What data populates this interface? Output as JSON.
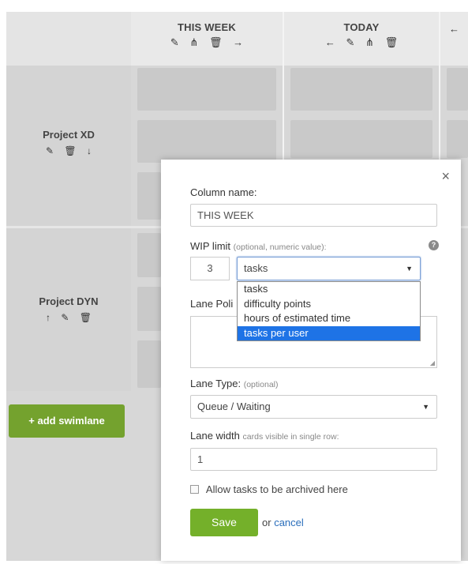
{
  "board": {
    "columns": [
      {
        "title": "THIS WEEK",
        "icons": [
          "pencil-icon",
          "hierarchy-icon",
          "trash-icon",
          "arrow-right-icon"
        ]
      },
      {
        "title": "TODAY",
        "icons": [
          "arrow-left-icon",
          "pencil-icon",
          "hierarchy-icon",
          "trash-icon"
        ]
      }
    ],
    "third_column_icon": "arrow-left-icon",
    "swimlanes": [
      {
        "name": "Project XD",
        "icons": [
          "pencil-icon",
          "trash-icon",
          "arrow-down-icon"
        ]
      },
      {
        "name": "Project DYN",
        "icons": [
          "arrow-up-icon",
          "pencil-icon",
          "trash-icon"
        ]
      }
    ],
    "add_swimlane_label": "+ add swimlane"
  },
  "modal": {
    "close_glyph": "×",
    "column_name_label": "Column name:",
    "column_name_value": "THIS WEEK",
    "wip_label": "WIP limit",
    "wip_hint": "(optional, numeric value):",
    "wip_value": "3",
    "wip_unit_selected": "tasks",
    "wip_unit_options": [
      "tasks",
      "difficulty points",
      "hours of estimated time",
      "tasks per user"
    ],
    "wip_unit_highlighted": "tasks per user",
    "lane_policy_label": "Lane Poli",
    "lane_type_label": "Lane Type:",
    "lane_type_hint": "(optional)",
    "lane_type_value": "Queue / Waiting",
    "lane_width_label": "Lane width",
    "lane_width_hint": "cards visible in single row:",
    "lane_width_value": "1",
    "archive_checkbox_label": "Allow tasks to be archived here",
    "archive_checked": false,
    "save_label": "Save",
    "or_text": "or",
    "cancel_label": "cancel"
  },
  "colors": {
    "accent_green": "#74b02a",
    "link_blue": "#2a6ebb",
    "highlight_blue": "#1e73e6"
  }
}
